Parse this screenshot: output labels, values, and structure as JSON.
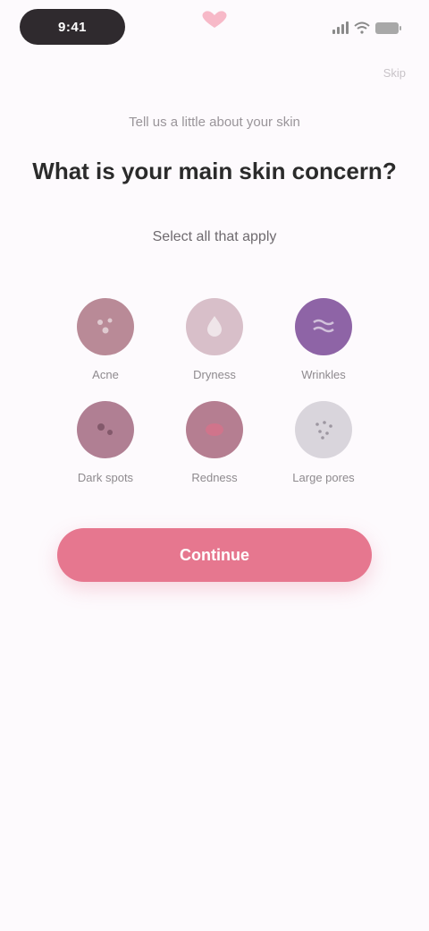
{
  "status_bar": {
    "time": "9:41"
  },
  "header": {
    "logo_icon": "heart-icon",
    "accent": "#ef8ea3",
    "skip_label": "Skip"
  },
  "content": {
    "eyebrow": "Tell us a little about your skin",
    "headline": "What is your main skin concern?",
    "subtitle": "Select all that apply"
  },
  "options": [
    {
      "label": "Acne",
      "icon": "acne-icon",
      "color": "#b98a97"
    },
    {
      "label": "Dryness",
      "icon": "dryness-icon",
      "color": "#d8bfc9"
    },
    {
      "label": "Wrinkles",
      "icon": "wrinkles-icon",
      "color": "#8e64a6"
    },
    {
      "label": "Dark spots",
      "icon": "dark-spots-icon",
      "color": "#b07f93"
    },
    {
      "label": "Redness",
      "icon": "redness-icon",
      "color": "#b57e91"
    },
    {
      "label": "Large pores",
      "icon": "pores-icon",
      "color": "#d9d5dc"
    }
  ],
  "cta": {
    "label": "Continue",
    "color": "#e6778f"
  }
}
